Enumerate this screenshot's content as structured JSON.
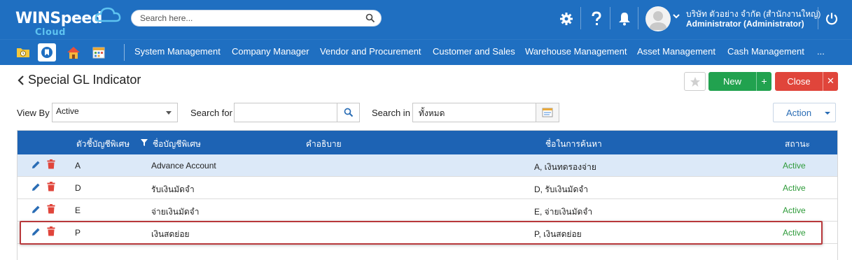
{
  "header": {
    "logo_main": "WINSpeed",
    "logo_sub": "Cloud",
    "search_placeholder": "Search here...",
    "company": "บริษัท ตัวอย่าง จำกัด (สำนักงานใหญ่)",
    "user": "Administrator (Administrator)",
    "icons": [
      "gear-icon",
      "help-icon",
      "bell-icon",
      "avatar",
      "chevron-down-icon",
      "power-icon"
    ]
  },
  "menu": {
    "tools": [
      "folder-clock-icon",
      "bookmark-icon",
      "home-icon",
      "calendar-icon"
    ],
    "items": [
      "System Management",
      "Company Manager",
      "Vendor and Procurement",
      "Customer and Sales",
      "Warehouse Management",
      "Asset Management",
      "Cash Management",
      "..."
    ]
  },
  "page": {
    "title": "Special GL Indicator",
    "new_label": "New",
    "new_plus": "+",
    "close_label": "Close",
    "close_x": "✕"
  },
  "filters": {
    "view_by_label": "View By",
    "view_by_value": "Active",
    "search_for_label": "Search for",
    "search_for_value": "",
    "search_in_label": "Search in",
    "search_in_value": "ทั้งหมด",
    "action_label": "Action"
  },
  "grid": {
    "columns": [
      "ตัวชี้บัญชีพิเศษ",
      "ชื่อบัญชีพิเศษ",
      "คำอธิบาย",
      "ชื่อในการค้นหา",
      "สถานะ"
    ],
    "rows": [
      {
        "code": "A",
        "name": "Advance Account",
        "desc": "",
        "search_name": "A, เงินทดรองจ่าย",
        "status": "Active"
      },
      {
        "code": "D",
        "name": "รับเงินมัดจำ",
        "desc": "",
        "search_name": "D, รับเงินมัดจำ",
        "status": "Active"
      },
      {
        "code": "E",
        "name": "จ่ายเงินมัดจำ",
        "desc": "",
        "search_name": "E, จ่ายเงินมัดจำ",
        "status": "Active"
      },
      {
        "code": "P",
        "name": "เงินสดย่อย",
        "desc": "",
        "search_name": "P, เงินสดย่อย",
        "status": "Active"
      }
    ],
    "selected_row": 0,
    "highlighted_row": 3
  },
  "colors": {
    "header_blue": "#1f6fc1",
    "grid_header": "#1d63b4",
    "new_green": "#21a24f",
    "close_red": "#e0453b",
    "status_green": "#2e9b3a",
    "highlight_red": "#b8383b"
  }
}
